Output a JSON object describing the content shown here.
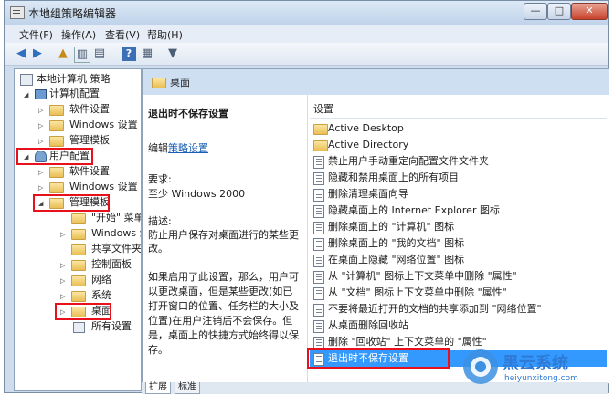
{
  "window": {
    "title": "本地组策略编辑器",
    "controls": {
      "minimize": "—",
      "maximize": "□",
      "close": "✕"
    }
  },
  "menubar": [
    "文件(F)",
    "操作(A)",
    "查看(V)",
    "帮助(H)"
  ],
  "toolbar": [
    "back-icon",
    "forward-icon",
    "up-folder-icon",
    "show-hide-tree-icon",
    "export-list-icon",
    "help-icon",
    "properties-icon",
    "filter-icon"
  ],
  "tree": [
    {
      "label": "本地计算机 策略",
      "expander": "",
      "icon": "computer-policy-icon"
    },
    {
      "label": "计算机配置",
      "expander": "◢",
      "icon": "computer-icon"
    },
    {
      "label": "软件设置",
      "expander": "▷",
      "icon": "folder-icon"
    },
    {
      "label": "Windows 设置",
      "expander": "▷",
      "icon": "folder-icon"
    },
    {
      "label": "管理模板",
      "expander": "▷",
      "icon": "folder-icon"
    },
    {
      "label": "用户配置",
      "expander": "◢",
      "icon": "user-icon"
    },
    {
      "label": "软件设置",
      "expander": "▷",
      "icon": "folder-icon"
    },
    {
      "label": "Windows 设置",
      "expander": "▷",
      "icon": "folder-icon"
    },
    {
      "label": "管理模板",
      "expander": "◢",
      "icon": "folder-icon"
    },
    {
      "label": "\"开始\" 菜单",
      "expander": "",
      "icon": "folder-icon"
    },
    {
      "label": "Windows 组",
      "expander": "▷",
      "icon": "folder-icon"
    },
    {
      "label": "共享文件夹",
      "expander": "",
      "icon": "folder-icon"
    },
    {
      "label": "控制面板",
      "expander": "▷",
      "icon": "folder-icon"
    },
    {
      "label": "网络",
      "expander": "▷",
      "icon": "folder-icon"
    },
    {
      "label": "系统",
      "expander": "▷",
      "icon": "folder-icon"
    },
    {
      "label": "桌面",
      "expander": "▷",
      "icon": "folder-icon"
    },
    {
      "label": "所有设置",
      "expander": "",
      "icon": "all-settings-icon"
    }
  ],
  "header": {
    "title": "桌面"
  },
  "description": {
    "setting_title": "退出时不保存设置",
    "edit_prefix": "编辑",
    "edit_link": "策略设置",
    "requirements_label": "要求:",
    "requirements_value": "至少 Windows 2000",
    "desc_label": "描述:",
    "desc_text": "防止用户保存对桌面进行的某些更改。",
    "desc_extra": "如果启用了此设置，那么，用户可以更改桌面，但是某些更改(如已打开窗口的位置、任务栏的大小及位置)在用户注销后不会保存。但是，桌面上的快捷方式始终得以保存。"
  },
  "settings": {
    "column_header": "设置",
    "items": [
      {
        "label": "Active Desktop",
        "type": "folder"
      },
      {
        "label": "Active Directory",
        "type": "folder"
      },
      {
        "label": "禁止用户手动重定向配置文件文件夹",
        "type": "setting"
      },
      {
        "label": "隐藏和禁用桌面上的所有项目",
        "type": "setting"
      },
      {
        "label": "删除清理桌面向导",
        "type": "setting"
      },
      {
        "label": "隐藏桌面上的 Internet Explorer 图标",
        "type": "setting"
      },
      {
        "label": "删除桌面上的 \"计算机\" 图标",
        "type": "setting"
      },
      {
        "label": "删除桌面上的 \"我的文档\" 图标",
        "type": "setting"
      },
      {
        "label": "在桌面上隐藏 \"网络位置\" 图标",
        "type": "setting"
      },
      {
        "label": "从 \"计算机\" 图标上下文菜单中删除 \"属性\"",
        "type": "setting"
      },
      {
        "label": "从 \"文档\" 图标上下文菜单中删除 \"属性\"",
        "type": "setting"
      },
      {
        "label": "不要将最近打开的文档的共享添加到 \"网络位置\"",
        "type": "setting"
      },
      {
        "label": "从桌面删除回收站",
        "type": "setting"
      },
      {
        "label": "删除 \"回收站\" 上下文菜单的 \"属性\"",
        "type": "setting"
      },
      {
        "label": "退出时不保存设置",
        "type": "setting",
        "selected": true
      }
    ]
  },
  "tabs": [
    "扩展",
    "标准"
  ],
  "watermark": {
    "brand": "黑云系统",
    "url": "heiyunxitong.com"
  },
  "colors": {
    "highlight": "#e8101a",
    "selection": "#3399ff",
    "link": "#1a5fb4"
  }
}
